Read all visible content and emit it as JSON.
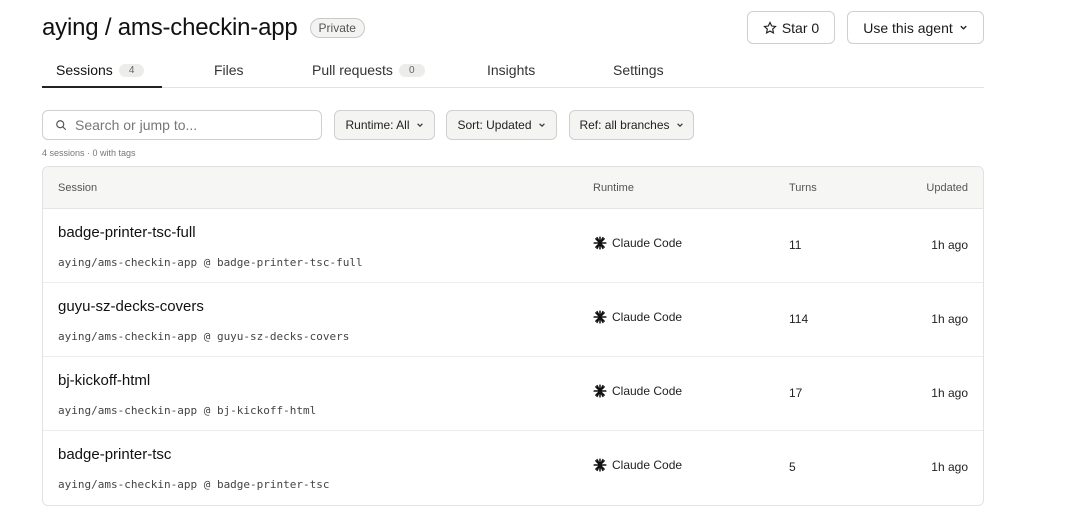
{
  "repo": {
    "title": "aying / ams-checkin-app",
    "visibility": "Private"
  },
  "actions": {
    "star_label": "Star 0",
    "agent_label": "Use this agent"
  },
  "tabs": [
    {
      "label": "Sessions",
      "count": "4"
    },
    {
      "label": "Files"
    },
    {
      "label": "Pull requests",
      "count": "0"
    },
    {
      "label": "Insights"
    },
    {
      "label": "Settings"
    }
  ],
  "search": {
    "placeholder": "Search or jump to..."
  },
  "filters": {
    "runtime": "Runtime: All",
    "sort": "Sort: Updated",
    "ref": "Ref: all branches"
  },
  "meta": "4 sessions · 0 with tags",
  "table": {
    "headers": {
      "session": "Session",
      "runtime": "Runtime",
      "turns": "Turns",
      "updated": "Updated"
    },
    "rows": [
      {
        "name": "badge-printer-tsc-full",
        "ref": "aying/ams-checkin-app @ badge-printer-tsc-full",
        "runtime": "Claude Code",
        "turns": "11",
        "updated": "1h ago"
      },
      {
        "name": "guyu-sz-decks-covers",
        "ref": "aying/ams-checkin-app @ guyu-sz-decks-covers",
        "runtime": "Claude Code",
        "turns": "114",
        "updated": "1h ago"
      },
      {
        "name": "bj-kickoff-html",
        "ref": "aying/ams-checkin-app @ bj-kickoff-html",
        "runtime": "Claude Code",
        "turns": "17",
        "updated": "1h ago"
      },
      {
        "name": "badge-printer-tsc",
        "ref": "aying/ams-checkin-app @ badge-printer-tsc",
        "runtime": "Claude Code",
        "turns": "5",
        "updated": "1h ago"
      }
    ]
  }
}
